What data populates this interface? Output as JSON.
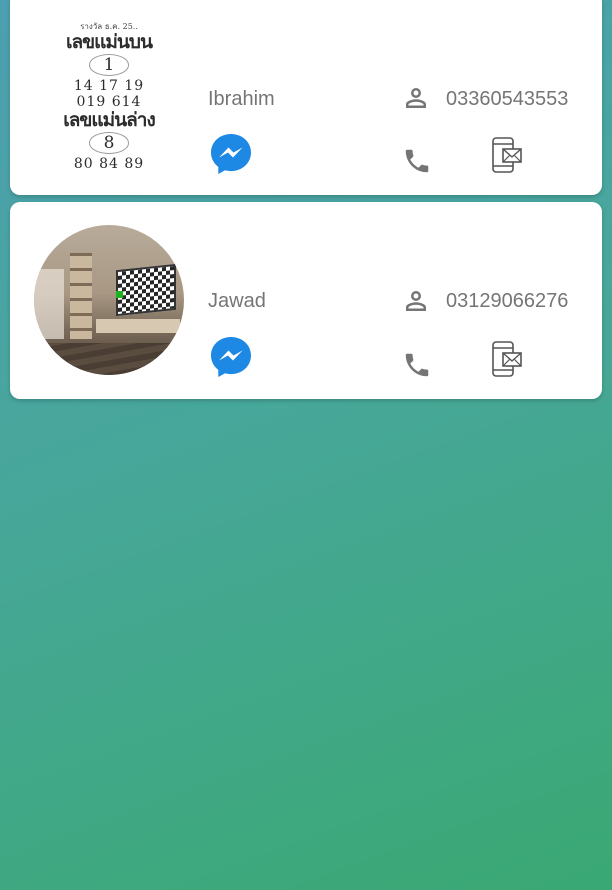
{
  "contacts": [
    {
      "name": "Ibrahim",
      "phone": "03360543553",
      "avatar": {
        "type": "lottery-ticket-photo",
        "small_text": "รางวัล ธ.ค. 25..",
        "heading_top": "เลขแม่นบน",
        "big_top": "1",
        "row1": "14  17  19",
        "row2": "019 614",
        "heading_bottom": "เลขแม่นล่าง",
        "big_bottom": "8",
        "row3": "80  84  89"
      }
    },
    {
      "name": "Jawad",
      "phone": "03129066276",
      "avatar": {
        "type": "living-room-photo"
      }
    }
  ],
  "icons": {
    "messenger": "messenger-icon",
    "person": "person-icon",
    "call": "phone-icon",
    "sms": "sms-icon"
  },
  "colors": {
    "messenger_blue": "#1e88e5",
    "icon_gray": "#757575",
    "text_gray": "#757575",
    "card_bg": "#ffffff"
  }
}
